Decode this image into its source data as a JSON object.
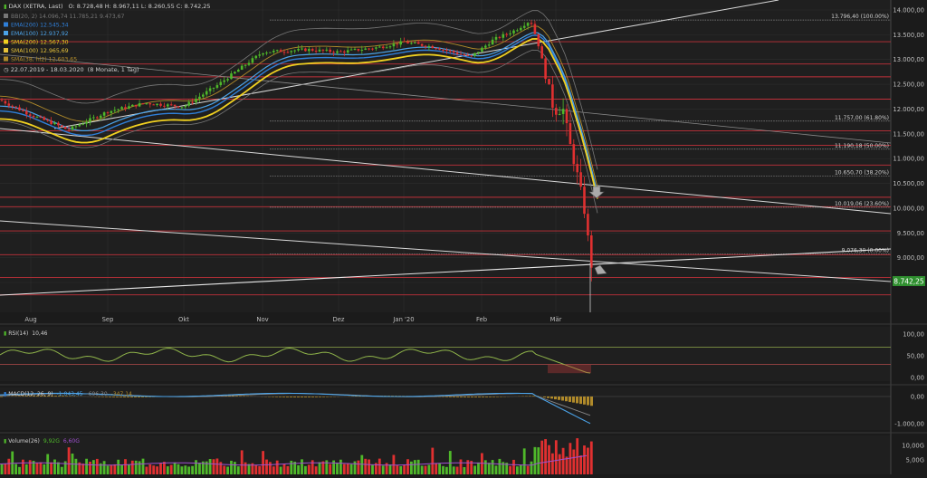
{
  "header": {
    "instrument": "DAX (XETRA, Last)",
    "ohlc": "O: 8.728,48  H: 8.967,11  L: 8.260,55  C: 8.742,25",
    "period": "22.07.2019 - 18.03.2020",
    "period_note": "(8 Monate, 1 Tag)"
  },
  "legend": [
    {
      "label": "BB(20, 2)",
      "value": "14.096,74  11.785,21  9.473,67",
      "color": "#777777"
    },
    {
      "label": "EMA(200)",
      "value": "12.545,34",
      "color": "#2f7fd8"
    },
    {
      "label": "EMA(100)",
      "value": "12.937,92",
      "color": "#4ba3e8"
    },
    {
      "label": "SMA(200)",
      "value": "12.567,30",
      "color": "#f0d020"
    },
    {
      "label": "SMA(100)",
      "value": "12.965,69",
      "color": "#e6c23a"
    },
    {
      "label": "SMA(38, hl2)",
      "value": "12.603,65",
      "color": "#b08a2a"
    }
  ],
  "price_axis": [
    "14.000,00",
    "13.500,00",
    "13.000,00",
    "12.500,00",
    "12.000,00",
    "11.500,00",
    "11.000,00",
    "10.500,00",
    "10.000,00",
    "9.500,00",
    "9.000,00",
    "8.500,00"
  ],
  "current_price": "8.742,25",
  "fib_levels": [
    {
      "label": "13.796,40 (100.00%)",
      "value": 13796.4
    },
    {
      "label": "11.757,00 (61.80%)",
      "value": 11757.0
    },
    {
      "label": "11.190,18 (50.00%)",
      "value": 11190.18
    },
    {
      "label": "10.650,70 (38.20%)",
      "value": 10650.7
    },
    {
      "label": "10.019,06 (23.60%)",
      "value": 10019.06
    },
    {
      "label": "9.076,30 (0.00%)",
      "value": 9076.3
    }
  ],
  "months": [
    "Aug",
    "Sep",
    "Okt",
    "Nov",
    "Dez",
    "Jan '20",
    "Feb",
    "Mär"
  ],
  "rsi": {
    "label": "RSI(14)",
    "value": "10,46",
    "axis": [
      "100,00",
      "50,00",
      "0,00"
    ]
  },
  "macd": {
    "label": "MACD(12, 26, 9)",
    "values": [
      "-1.043,45",
      "-696,30",
      "-347,14"
    ],
    "axis": [
      "0,00",
      "-1.000,00"
    ]
  },
  "volume": {
    "label": "Volume(26)",
    "values": [
      "9,92G",
      "6,60G"
    ],
    "axis": [
      "10,00G",
      "5,00G"
    ]
  },
  "colors": {
    "up": "#4fb82a",
    "down": "#e03030",
    "hline": "#c0303a",
    "grid": "#2e2e2e",
    "price_tag": "#2f8f2f"
  },
  "chart_data": {
    "type": "line",
    "title": "DAX (XETRA, Last)",
    "x": [
      "2019-08",
      "2019-09",
      "2019-10",
      "2019-11",
      "2019-12",
      "2020-01",
      "2020-02",
      "2020-02-19",
      "2020-03-05",
      "2020-03-12",
      "2020-03-16",
      "2020-03-18"
    ],
    "series": [
      {
        "name": "DAX",
        "values": [
          11750,
          12150,
          12350,
          13150,
          13300,
          13400,
          13550,
          13789,
          11700,
          9160,
          8740,
          8742
        ]
      }
    ],
    "ylim": [
      8200,
      14200
    ],
    "horizontal_levels": [
      13796.4,
      11757.0,
      11190.18,
      10650.7,
      10019.06,
      9076.3
    ],
    "rsi_last": 10.46,
    "macd_last": [
      -1043.45,
      -696.3,
      -347.14
    ],
    "volume_last": [
      "9,92G",
      "6,60G"
    ]
  }
}
